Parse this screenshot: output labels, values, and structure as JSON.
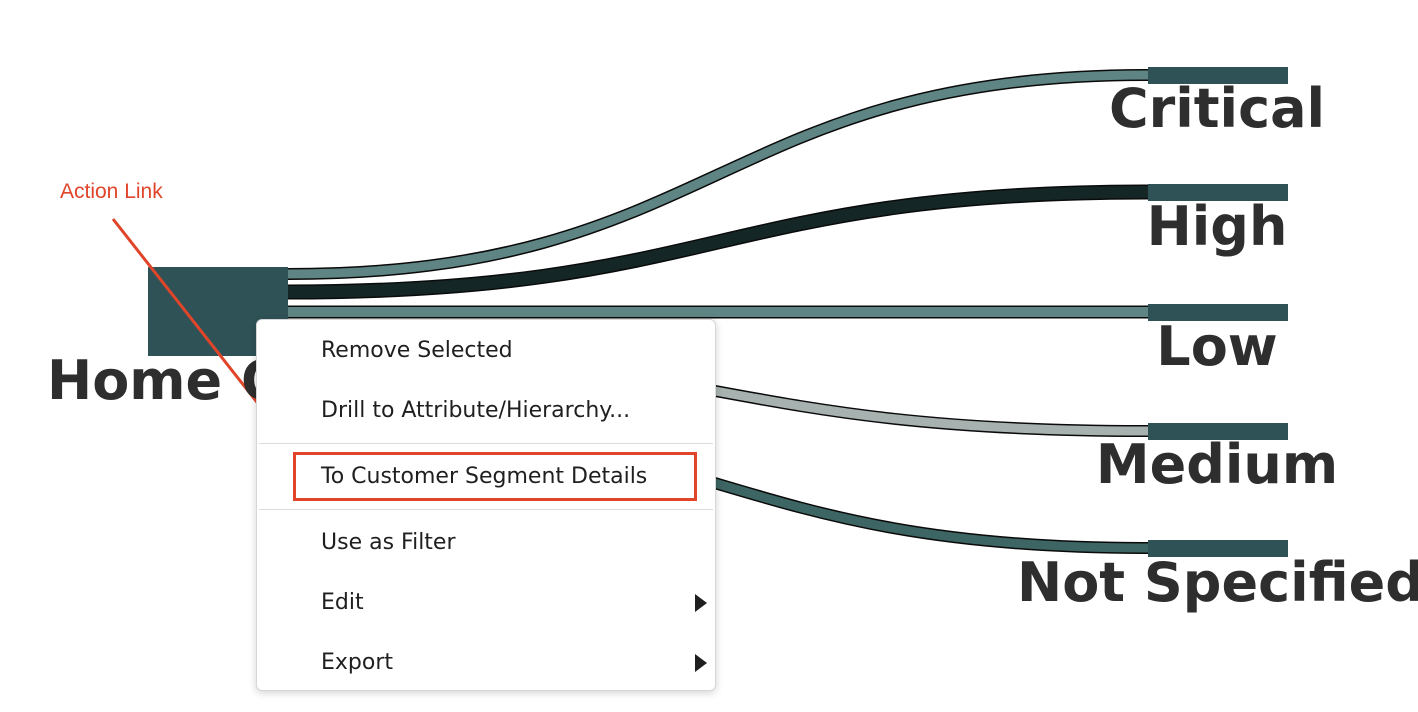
{
  "source_node": {
    "label": "Home O",
    "color": "#2f5257"
  },
  "targets": [
    {
      "label": "Critical",
      "link_color": "#5e8583"
    },
    {
      "label": "High",
      "link_color": "#142726"
    },
    {
      "label": "Low",
      "link_color": "#5e8583"
    },
    {
      "label": "Medium",
      "link_color": "#a7b2b0"
    },
    {
      "label": "Not Specified",
      "link_color": "#3d6563"
    }
  ],
  "target_node_color": "#2f5257",
  "callout": {
    "text": "Action Link",
    "color": "#e0452a"
  },
  "context_menu": {
    "items": [
      {
        "label": "Remove Selected",
        "submenu": false
      },
      {
        "label": "Drill to Attribute/Hierarchy...",
        "submenu": false
      },
      {
        "label": "To Customer Segment Details",
        "submenu": false,
        "highlighted": true
      },
      {
        "label": "Use as Filter",
        "submenu": false
      },
      {
        "label": "Edit",
        "submenu": true
      },
      {
        "label": "Export",
        "submenu": true
      }
    ]
  }
}
